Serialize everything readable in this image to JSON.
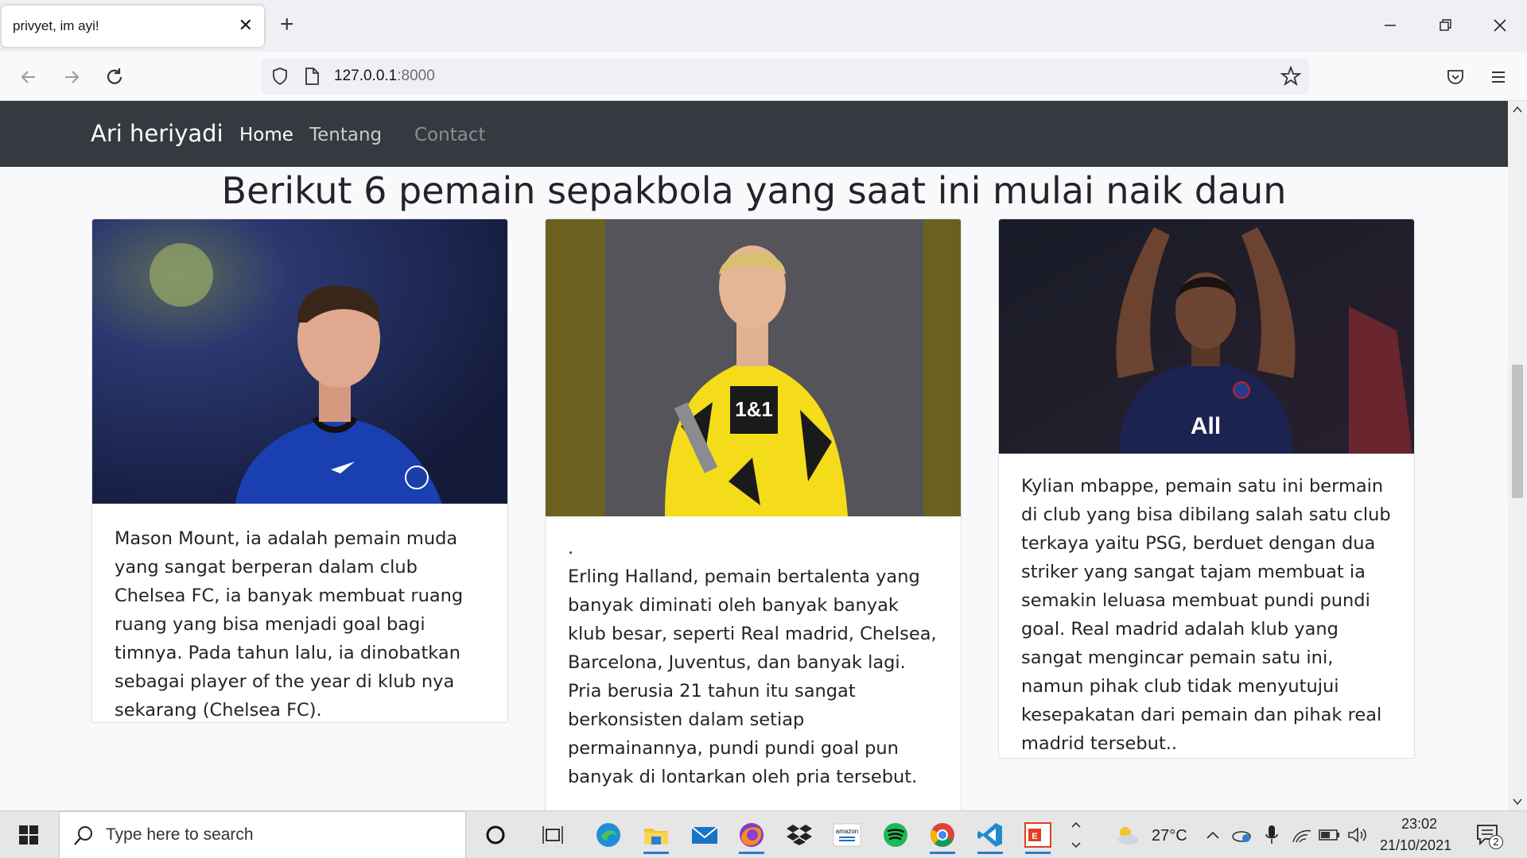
{
  "browser": {
    "tab_title": "privyet, im ayi!",
    "url_host": "127.0.0.1",
    "url_port": ":8000"
  },
  "site": {
    "brand": "Ari heriyadi",
    "nav": [
      {
        "label": "Home",
        "color": "#ffffff"
      },
      {
        "label": "Tentang",
        "color": "#c9cbcd"
      },
      {
        "label": "Contact",
        "color": "#8a8f94"
      }
    ],
    "heading": "Berikut 6 pemain sepakbola yang saat ini mulai naik daun"
  },
  "cards": [
    {
      "image_subject": "Mason Mount in blue Chelsea kit",
      "text": "Mason Mount, ia adalah pemain muda yang sangat berperan dalam club Chelsea FC, ia banyak membuat ruang ruang yang bisa menjadi goal bagi timnya. Pada tahun lalu, ia dinobatkan sebagai player of the year di klub nya sekarang (Chelsea FC)."
    },
    {
      "image_subject": "Erling Haaland in yellow Dortmund kit holding trophy",
      "dot": ".",
      "text": "Erling Halland, pemain bertalenta yang banyak diminati oleh banyak banyak klub besar, seperti Real madrid, Chelsea, Barcelona, Juventus, dan banyak lagi. Pria berusia 21 tahun itu sangat berkonsisten dalam setiap permainannya, pundi pundi goal pun banyak di lontarkan oleh pria tersebut."
    },
    {
      "image_subject": "Kylian Mbappe in PSG kit clapping",
      "text": "Kylian mbappe, pemain satu ini bermain di club yang bisa dibilang salah satu club terkaya yaitu PSG, berduet dengan dua striker yang sangat tajam membuat ia semakin leluasa membuat pundi pundi goal. Real madrid adalah klub yang sangat mengincar pemain satu ini, namun pihak club tidak menyutujui kesepakatan dari pemain dan pihak real madrid tersebut.."
    }
  ],
  "taskbar": {
    "search_placeholder": "Type here to search",
    "temperature": "27°C",
    "time": "23:02",
    "date": "21/10/2021",
    "notification_count": "2",
    "pinned_apps": [
      "cortana",
      "task-view",
      "edge",
      "file-explorer",
      "mail",
      "firefox",
      "dropbox",
      "amazon",
      "spotify",
      "chrome",
      "vscode",
      "office"
    ]
  }
}
